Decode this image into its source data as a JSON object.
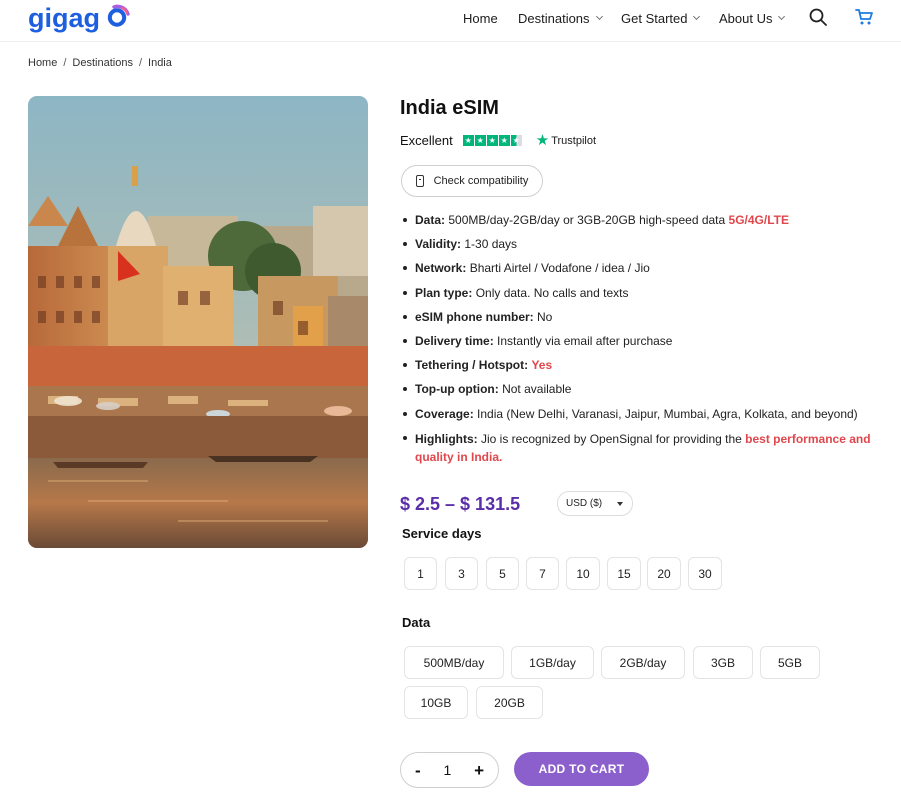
{
  "brand": {
    "logo_text": "gigago",
    "accent": "#5a2ea8",
    "logo_blue": "#1e5fe0"
  },
  "nav": {
    "home": "Home",
    "destinations": "Destinations",
    "get_started": "Get Started",
    "about_us": "About Us",
    "icons": [
      "search-icon",
      "cart-icon"
    ]
  },
  "breadcrumb": {
    "home": "Home",
    "destinations": "Destinations",
    "current": "India",
    "sep": "/"
  },
  "product": {
    "title": "India eSIM",
    "rating_label": "Excellent",
    "rating_stars": 4.5,
    "trustpilot": "Trustpilot",
    "check_compat": "Check compatibility",
    "specs": {
      "data_label": "Data:",
      "data_text": "500MB/day-2GB/day or 3GB-20GB high-speed data",
      "data_highlight": "5G/4G/LTE",
      "validity_label": "Validity:",
      "validity_text": "1-30 days",
      "network_label": "Network:",
      "network_text": "Bharti Airtel / Vodafone / idea / Jio",
      "plan_label": "Plan type:",
      "plan_text": "Only data. No calls and texts",
      "number_label": "eSIM phone number:",
      "number_text": "No",
      "delivery_label": "Delivery time:",
      "delivery_text": "Instantly via email after purchase",
      "tethering_label": "Tethering / Hotspot:",
      "tethering_text": "Yes",
      "topup_label": "Top-up option:",
      "topup_text": "Not available",
      "coverage_label": "Coverage:",
      "coverage_text": "India (New Delhi, Varanasi, Jaipur, Mumbai, Agra, Kolkata, and beyond)",
      "highlights_label": "Highlights:",
      "highlights_text": "Jio is recognized by OpenSignal for providing the",
      "highlights_red1": "best performance and",
      "highlights_red2": "quality in India."
    },
    "price": "$ 2.5 – $ 131.5",
    "currency": "USD ($)",
    "service_days_label": "Service days",
    "service_days": [
      "1",
      "3",
      "5",
      "7",
      "10",
      "15",
      "20",
      "30"
    ],
    "data_label": "Data",
    "data_options": [
      "500MB/day",
      "1GB/day",
      "2GB/day",
      "3GB",
      "5GB",
      "10GB",
      "20GB"
    ],
    "quantity": "1",
    "minus": "-",
    "plus": "+",
    "add_to_cart": "ADD TO CART"
  }
}
